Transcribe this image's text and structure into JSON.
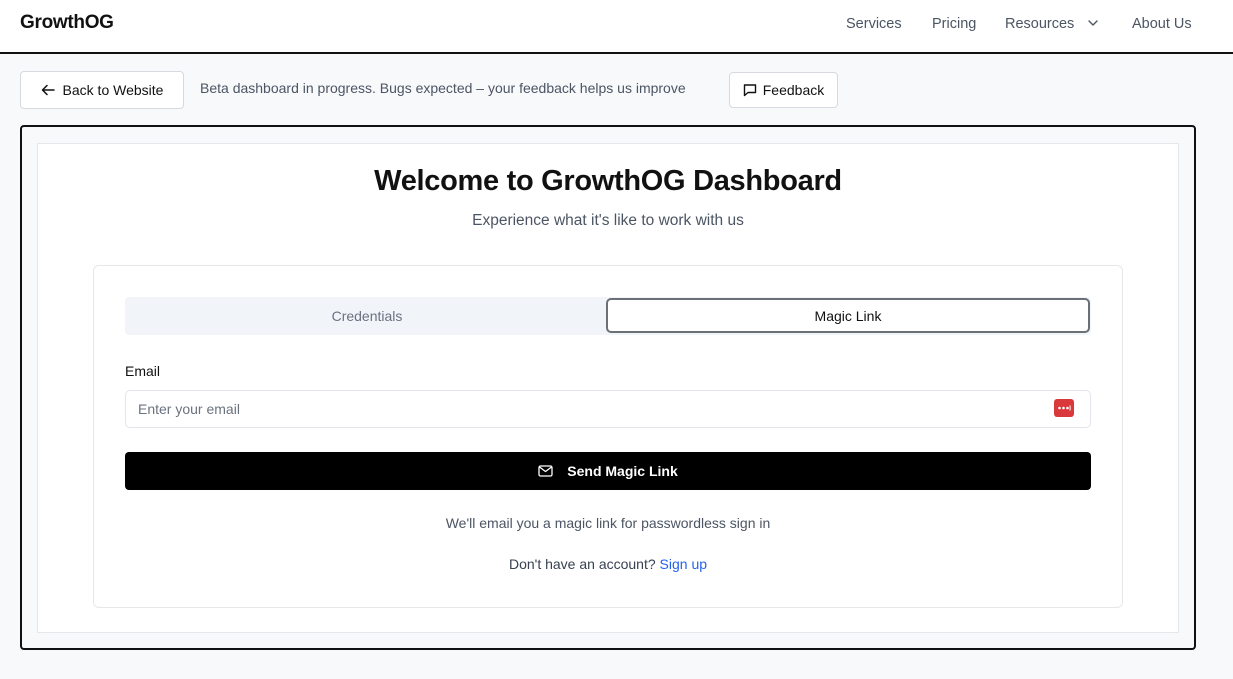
{
  "header": {
    "logo": "GrowthOG",
    "nav": {
      "services": "Services",
      "pricing": "Pricing",
      "resources": "Resources",
      "about": "About Us"
    }
  },
  "beta_bar": {
    "back_label": "Back to Website",
    "message": "Beta dashboard in progress. Bugs expected – your feedback helps us improve",
    "feedback_label": "Feedback"
  },
  "main": {
    "title": "Welcome to GrowthOG Dashboard",
    "subtitle": "Experience what it's like to work with us",
    "tabs": [
      {
        "label": "Credentials",
        "active": false
      },
      {
        "label": "Magic Link",
        "active": true
      }
    ],
    "email": {
      "label": "Email",
      "placeholder": "Enter your email",
      "value": ""
    },
    "send_button_label": "Send Magic Link",
    "hint": "We'll email you a magic link for passwordless sign in",
    "signup_prompt": "Don't have an account?",
    "signup_link": "Sign up"
  },
  "colors": {
    "primary_button": "#000000",
    "link": "#2563eb",
    "password_manager_icon": "#d9393b"
  }
}
